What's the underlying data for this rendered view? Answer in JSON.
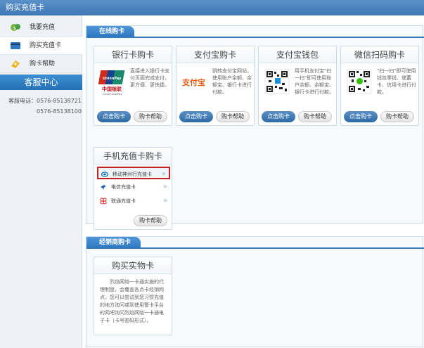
{
  "window": {
    "title": "购买充值卡"
  },
  "sidebar": {
    "items": [
      {
        "label": "我要充值",
        "icon": "recharge-icon"
      },
      {
        "label": "购买充值卡",
        "icon": "card-icon"
      },
      {
        "label": "购卡帮助",
        "icon": "help-icon"
      }
    ],
    "service_title": "客服中心",
    "phone_label": "客服电话：",
    "phones": [
      "0576-85138721",
      "0576-85138100"
    ]
  },
  "online": {
    "tab_label": "在线购卡",
    "cards": [
      {
        "title": "银行卡购卡",
        "logo": "unionpay-logo",
        "desc": "直接进入银行卡支付页面完成支付，更方便、更快捷。",
        "buy": "点击购卡",
        "help": "购卡帮助"
      },
      {
        "title": "支付宝购卡",
        "logo": "alipay-logo",
        "desc": "跳转支付宝网站，使用账户余额、余额宝、银行卡进行付款。",
        "buy": "点击购卡",
        "help": "购卡帮助"
      },
      {
        "title": "支付宝钱包",
        "logo": "alipay-qr-code",
        "desc": "用手机支付宝\"扫一扫\"即可使用账户余额、余额宝、银行卡进行付款。",
        "buy": "点击购卡",
        "help": "购卡帮助"
      },
      {
        "title": "微信扫码购卡",
        "logo": "wechat-qr-code",
        "desc": "\"扫一扫\"即可使用钱包零钱、储蓄卡、信用卡进行付款。",
        "buy": "点击购卡",
        "help": "购卡帮助"
      }
    ],
    "mobile": {
      "title": "手机充值卡购卡",
      "carriers": [
        {
          "label": "移动神州行充值卡",
          "icon": "china-mobile-icon"
        },
        {
          "label": "电信充值卡",
          "icon": "china-telecom-icon"
        },
        {
          "label": "联通充值卡",
          "icon": "china-unicom-icon"
        }
      ],
      "help": "购卡帮助"
    }
  },
  "dealer": {
    "tab_label": "经销商购卡",
    "card_title": "购买实物卡",
    "desc": "烈焰网络一卡通实施的代理制度，会覆盖各点卡经销网点，您可以尝试到您习惯充值的地方询问或到使用警卡平台的网吧询问烈焰网络一卡通电子卡（卡号密码形式）。"
  },
  "colors": {
    "accent": "#2f78c0",
    "selected_border": "#c71f24",
    "title_bar": "#4a84c0"
  }
}
